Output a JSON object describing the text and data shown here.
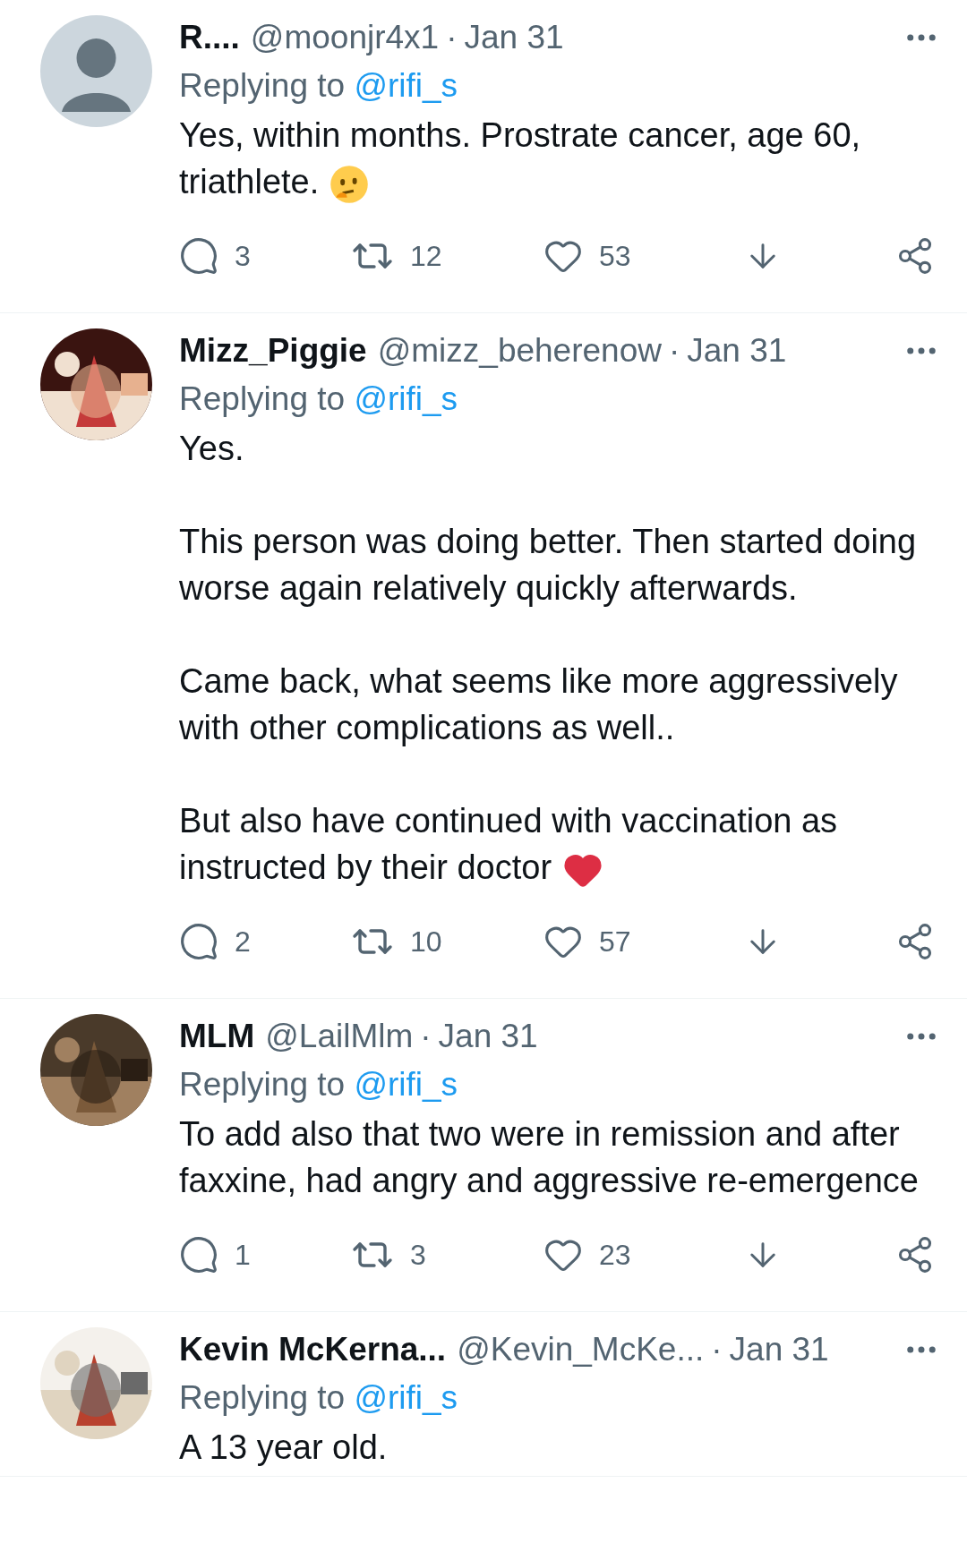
{
  "tweets": [
    {
      "avatar": {
        "kind": "default"
      },
      "name": "R....",
      "handle": "@moonjr4x1",
      "separator": "·",
      "date": "Jan 31",
      "replying_label": "Replying to",
      "replying_to": "@rifi_s",
      "body": [
        "Yes, within months. Prostrate cancer, age 60, triathlete."
      ],
      "replies": "3",
      "retweets": "12",
      "likes": "53"
    },
    {
      "name": "Mizz_Piggie",
      "handle": "@mizz_beherenow",
      "separator": "·",
      "date": "Jan 31",
      "replying_label": "Replying to",
      "replying_to": "@rifi_s",
      "body": [
        "Yes.",
        "This person was doing better. Then started doing worse again relatively quickly afterwards.",
        "Came back, what seems like more aggressively with other complications as well..",
        "But also have continued with vaccination as instructed by their doctor"
      ],
      "replies": "2",
      "retweets": "10",
      "likes": "57"
    },
    {
      "name": "MLM",
      "handle": "@LailMlm",
      "separator": "·",
      "date": "Jan 31",
      "replying_label": "Replying to",
      "replying_to": "@rifi_s",
      "body": [
        "To add also that two were in remission and after faxxine, had angry and aggressive re-emergence"
      ],
      "replies": "1",
      "retweets": "3",
      "likes": "23"
    },
    {
      "name": "Kevin McKerna...",
      "handle": "@Kevin_McKe...",
      "separator": "·",
      "date": "Jan 31",
      "replying_label": "Replying to",
      "replying_to": "@rifi_s",
      "body": [
        "A 13 year old."
      ]
    }
  ]
}
